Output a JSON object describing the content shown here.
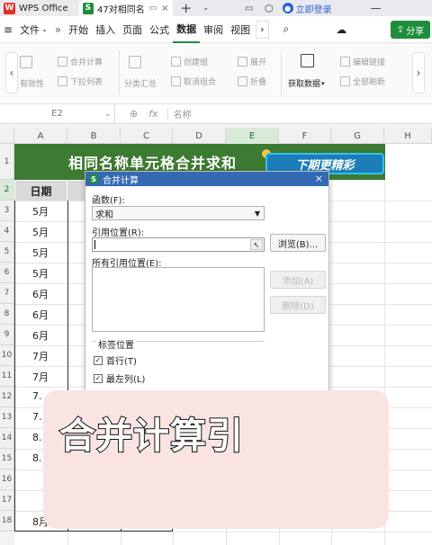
{
  "titlebar": {
    "app_tab": "WPS Office",
    "doc_tab": "47对相同名",
    "login": "立即登录"
  },
  "menubar": {
    "file": "文件",
    "items": [
      "开始",
      "插入",
      "页面",
      "公式",
      "数据",
      "审阅",
      "视图"
    ],
    "active": "数据",
    "share": "分享"
  },
  "ribbon": {
    "buttons": [
      "有效性",
      "合并计算",
      "下拉列表",
      "分类汇总",
      "创建组",
      "取消组合",
      "展开",
      "折叠",
      "获取数据",
      "编辑链接",
      "全部刷新"
    ]
  },
  "formula_bar": {
    "cell_ref": "E2",
    "fx": "fx",
    "name_placeholder": "名称"
  },
  "columns": [
    "A",
    "B",
    "C",
    "D",
    "E",
    "F",
    "G",
    "H"
  ],
  "selected_column": "E",
  "rows": [
    "1",
    "2",
    "3",
    "4",
    "5",
    "6",
    "7",
    "8",
    "9",
    "10",
    "11",
    "12",
    "13",
    "14",
    "15",
    "16",
    "17",
    "18"
  ],
  "selected_row": "2",
  "sheet": {
    "banner_title": "相同名称单元格合并求和",
    "badge": "下期更精彩",
    "header_date": "日期",
    "dates": [
      "5月",
      "5月",
      "5月",
      "5月",
      "6月",
      "6月",
      "6月",
      "7月",
      "7月",
      "7.",
      "7.",
      "8.",
      "8.",
      "8月"
    ]
  },
  "dialog": {
    "title": "合并计算",
    "function_label": "函数(F):",
    "function_value": "求和",
    "ref_label": "引用位置(R):",
    "browse": "浏览(B)...",
    "all_refs_label": "所有引用位置(E):",
    "add": "添加(A)",
    "delete": "删除(D)",
    "tag_label": "标签位置",
    "top_row": "首行(T)",
    "left_col": "最左列(L)",
    "close": "×"
  },
  "overlay": {
    "caption": "合并计算引"
  }
}
